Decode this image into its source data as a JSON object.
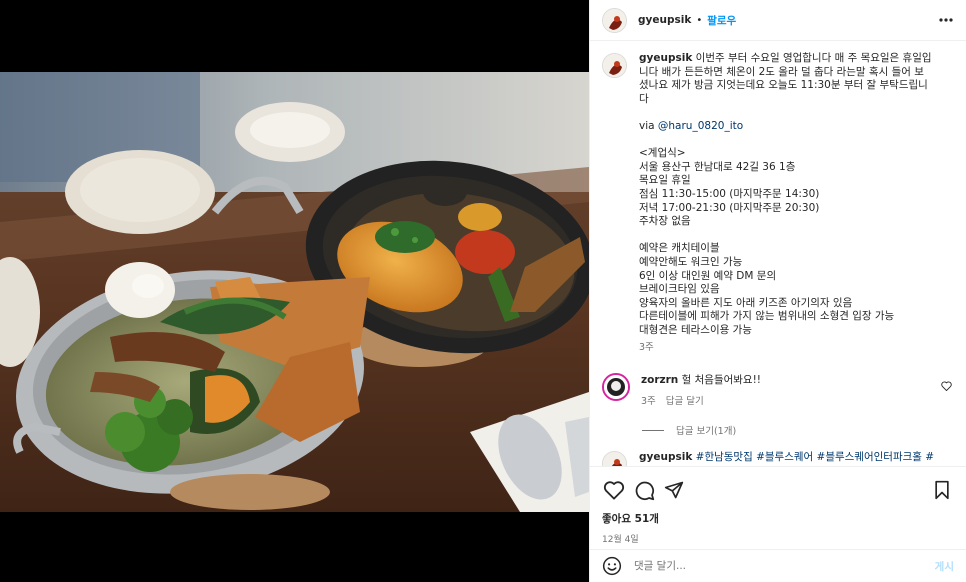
{
  "post": {
    "username": "gyeupsik",
    "dot": "•",
    "follow_label": "팔로우",
    "caption_lines": [
      "이번주 부터 수요일 영업합니다 매 주 목요일은 휴일입",
      "니다 배가 든든하면 체온이 2도 올라 덜 춥다 라는말 혹시 들어 보",
      "셨나요 제가 방금 지엇는데요 오늘도 11:30분 부터 잘 부탁드립니",
      "다"
    ],
    "via_prefix": "via ",
    "via_mention": "@haru_0820_ito",
    "info_lines": [
      "<계업식>",
      "서울 용산구 한남대로 42길 36 1층",
      "목요일 휴일",
      "점심 11:30-15:00 (마지막주문 14:30)",
      "저녁 17:00-21:30 (마지막주문 20:30)",
      "주차장 없음"
    ],
    "notice_lines": [
      "예약은 캐치테이블",
      "예약안해도 워크인 가능",
      "6인 이상 대인원 예약 DM 문의",
      "브레이크타임 있음",
      "양육자의 올바른 지도 아래 키즈존 아기의자 있음",
      "다른테이블에 피해가 가지 않는 범위내의 소형견 입장 가능",
      "대형견은 테라스이용 가능"
    ],
    "caption_time": "3주"
  },
  "comments": [
    {
      "username": "zorzrn",
      "text": "헐 처음들어봐요!!",
      "time": "3주",
      "reply_label": "답글 달기",
      "view_replies": "답글 보기(1개)"
    }
  ],
  "second_caption": {
    "username": "gyeupsik",
    "hashtags": "#한남동맛집 #블루스퀘어 #블루스퀘어인터파크홀 #"
  },
  "actions": {
    "likes": "좋아요 51개",
    "date": "12월 4일"
  },
  "comment_box": {
    "placeholder": "댓글 달기...",
    "post_label": "게시"
  },
  "icons": [
    "more-icon",
    "heart-icon",
    "comment-icon",
    "share-icon",
    "bookmark-icon",
    "emoji-icon",
    "small-heart-icon"
  ],
  "colors": {
    "accent": "#0095f6",
    "link": "#00376b",
    "muted": "#737373",
    "post_disabled": "#b2dffc"
  }
}
